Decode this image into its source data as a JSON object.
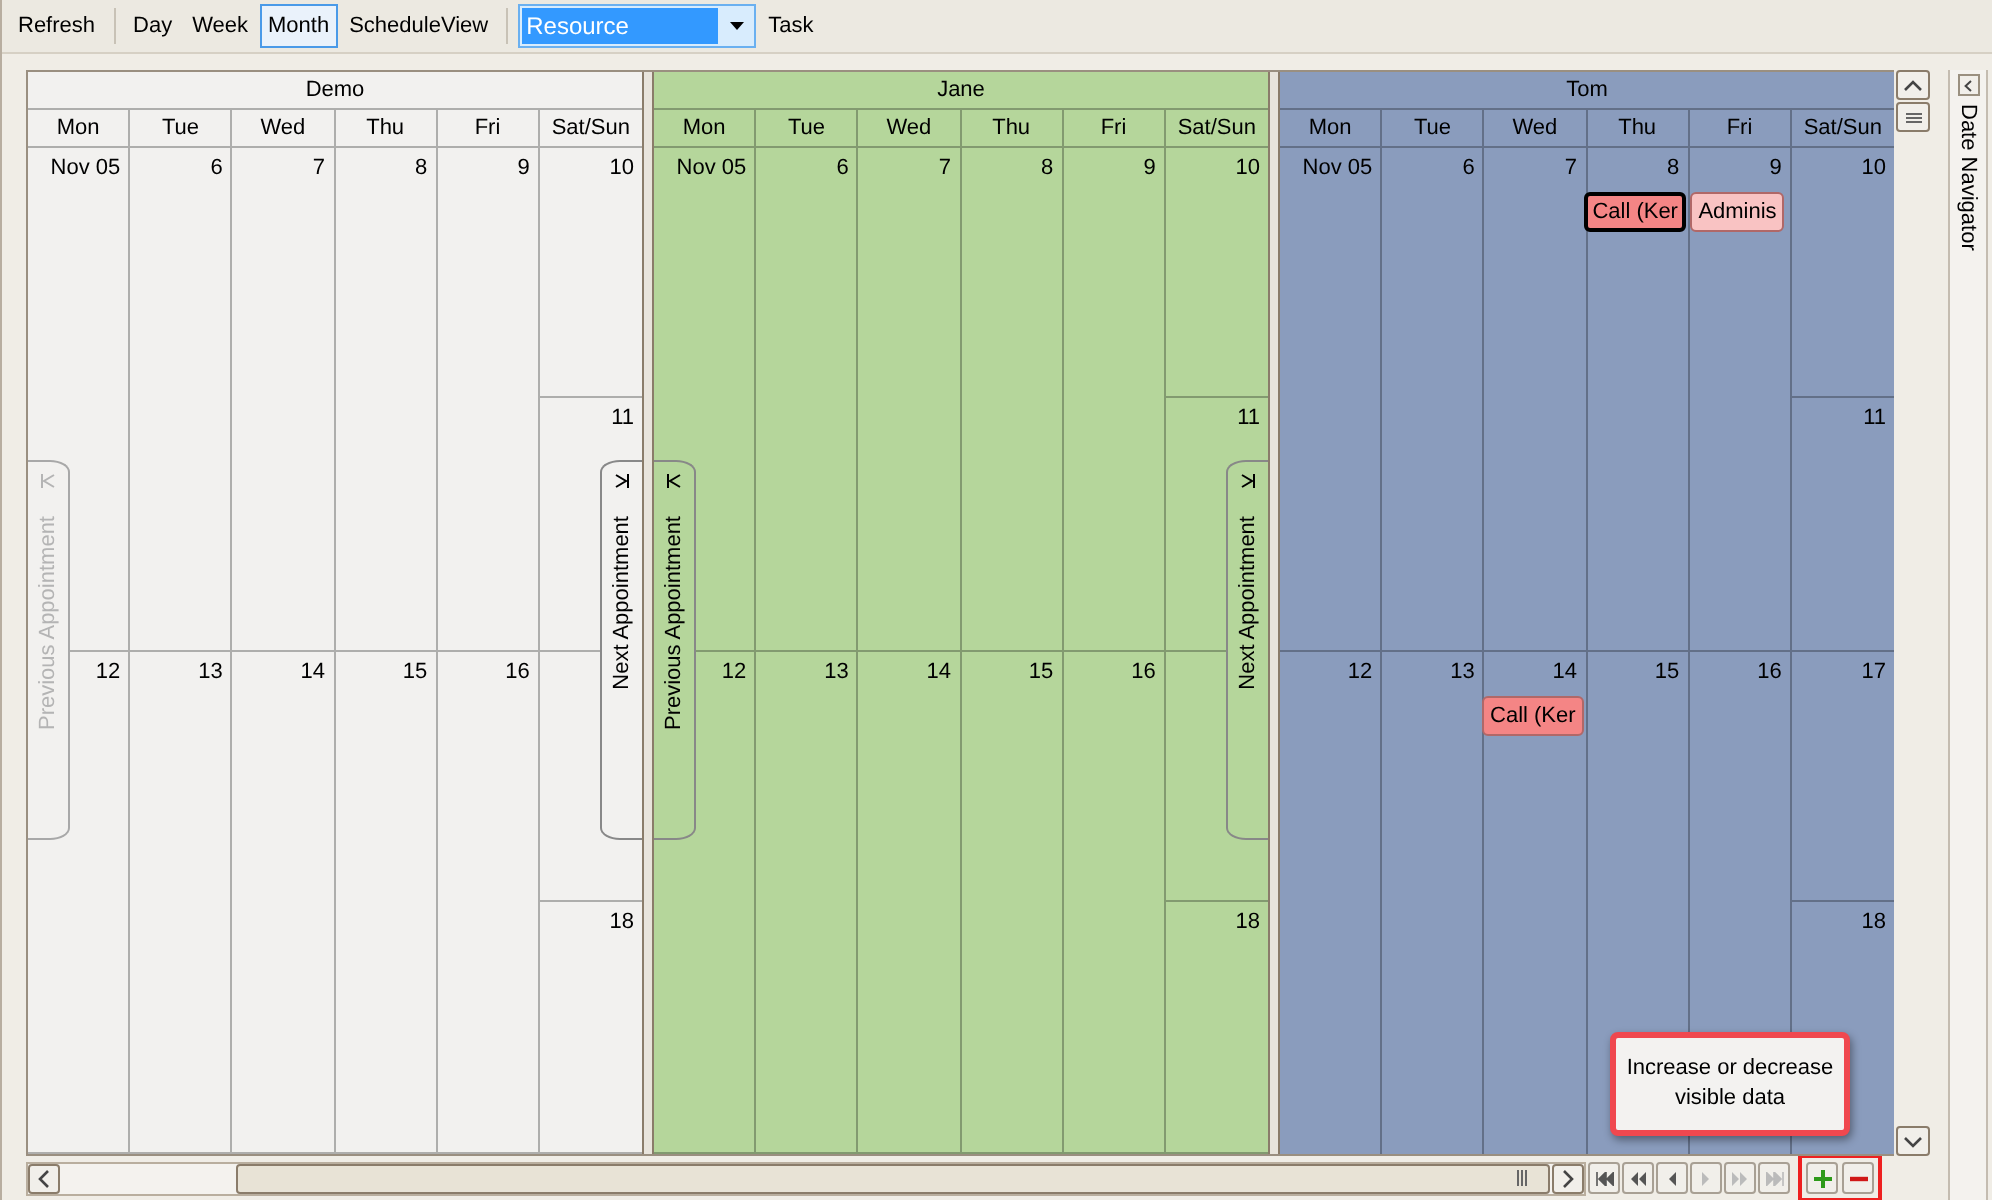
{
  "toolbar": {
    "groups": [
      [
        {
          "label": "Refresh",
          "selected": false
        }
      ],
      [
        {
          "label": "Day",
          "selected": false
        },
        {
          "label": "Week",
          "selected": false
        },
        {
          "label": "Month",
          "selected": true
        },
        {
          "label": "ScheduleView",
          "selected": false
        }
      ]
    ],
    "view_select": {
      "value": "Resource"
    },
    "task_button": "Task"
  },
  "resources": [
    {
      "name": "Demo",
      "color": "#f2f1ef",
      "day_names": [
        "Mon",
        "Tue",
        "Wed",
        "Thu",
        "Fri",
        "Sat/Sun"
      ],
      "weeks": [
        {
          "days": [
            {
              "date": "Nov 05"
            },
            {
              "date": "6"
            },
            {
              "date": "7"
            },
            {
              "date": "8"
            },
            {
              "date": "9"
            }
          ],
          "saturday": {
            "date": "10"
          },
          "sunday": {
            "date": "11"
          }
        },
        {
          "days": [
            {
              "date": "12"
            },
            {
              "date": "13"
            },
            {
              "date": "14"
            },
            {
              "date": "15"
            },
            {
              "date": "16"
            }
          ],
          "sunday": {
            "date": "18"
          }
        }
      ],
      "nav_tabs": [
        {
          "label": "Previous Appointment",
          "kind": "previous",
          "disabled": true
        },
        {
          "label": "Next Appointment",
          "kind": "next",
          "disabled": false
        }
      ]
    },
    {
      "name": "Jane",
      "color": "#b5d69b",
      "day_names": [
        "Mon",
        "Tue",
        "Wed",
        "Thu",
        "Fri",
        "Sat/Sun"
      ],
      "weeks": [
        {
          "days": [
            {
              "date": "Nov 05"
            },
            {
              "date": "6"
            },
            {
              "date": "7"
            },
            {
              "date": "8"
            },
            {
              "date": "9"
            }
          ],
          "saturday": {
            "date": "10"
          },
          "sunday": {
            "date": "11"
          }
        },
        {
          "days": [
            {
              "date": "12"
            },
            {
              "date": "13"
            },
            {
              "date": "14"
            },
            {
              "date": "15"
            },
            {
              "date": "16"
            }
          ],
          "sunday": {
            "date": "18"
          }
        }
      ],
      "nav_tabs": [
        {
          "label": "Previous Appointment",
          "kind": "previous",
          "disabled": false
        },
        {
          "label": "Next Appointment",
          "kind": "next",
          "disabled": false
        }
      ]
    },
    {
      "name": "Tom",
      "color": "#8a9cbd",
      "day_names": [
        "Mon",
        "Tue",
        "Wed",
        "Thu",
        "Fri",
        "Sat/Sun"
      ],
      "weeks": [
        {
          "days": [
            {
              "date": "Nov 05"
            },
            {
              "date": "6"
            },
            {
              "date": "7"
            },
            {
              "date": "8",
              "appointments": [
                {
                  "text": "Call (Ker",
                  "color": "#f48585",
                  "selected": true
                }
              ]
            },
            {
              "date": "9",
              "appointments": [
                {
                  "text": "Adminis",
                  "color": "#f9c3c3",
                  "selected": false
                }
              ]
            }
          ],
          "saturday": {
            "date": "10"
          },
          "sunday": {
            "date": "11"
          }
        },
        {
          "days": [
            {
              "date": "12"
            },
            {
              "date": "13"
            },
            {
              "date": "14",
              "appointments": [
                {
                  "text": "Call (Ker",
                  "color": "#f48585",
                  "selected": false
                }
              ]
            },
            {
              "date": "15"
            },
            {
              "date": "16"
            }
          ],
          "saturday": {
            "date": "17"
          },
          "sunday": {
            "date": "18"
          }
        }
      ]
    }
  ],
  "tooltip": "Increase or decrease visible data",
  "date_navigator": {
    "label": "Date Navigator"
  }
}
